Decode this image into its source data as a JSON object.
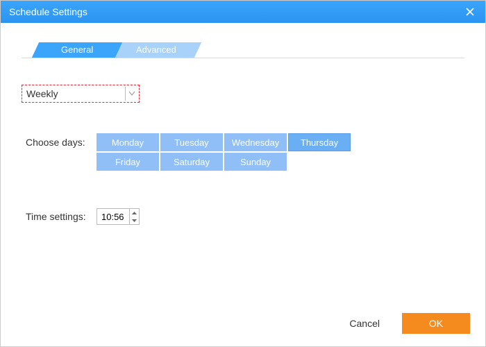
{
  "title": "Schedule Settings",
  "tabs": {
    "general": "General",
    "advanced": "Advanced"
  },
  "schedule_type": "Weekly",
  "choose_days_label": "Choose days:",
  "days": {
    "d0": "Monday",
    "d1": "Tuesday",
    "d2": "Wednesday",
    "d3": "Thursday",
    "d4": "Friday",
    "d5": "Saturday",
    "d6": "Sunday"
  },
  "selected_day": "Thursday",
  "time_label": "Time settings:",
  "time_value": "10:56",
  "buttons": {
    "cancel": "Cancel",
    "ok": "OK"
  }
}
